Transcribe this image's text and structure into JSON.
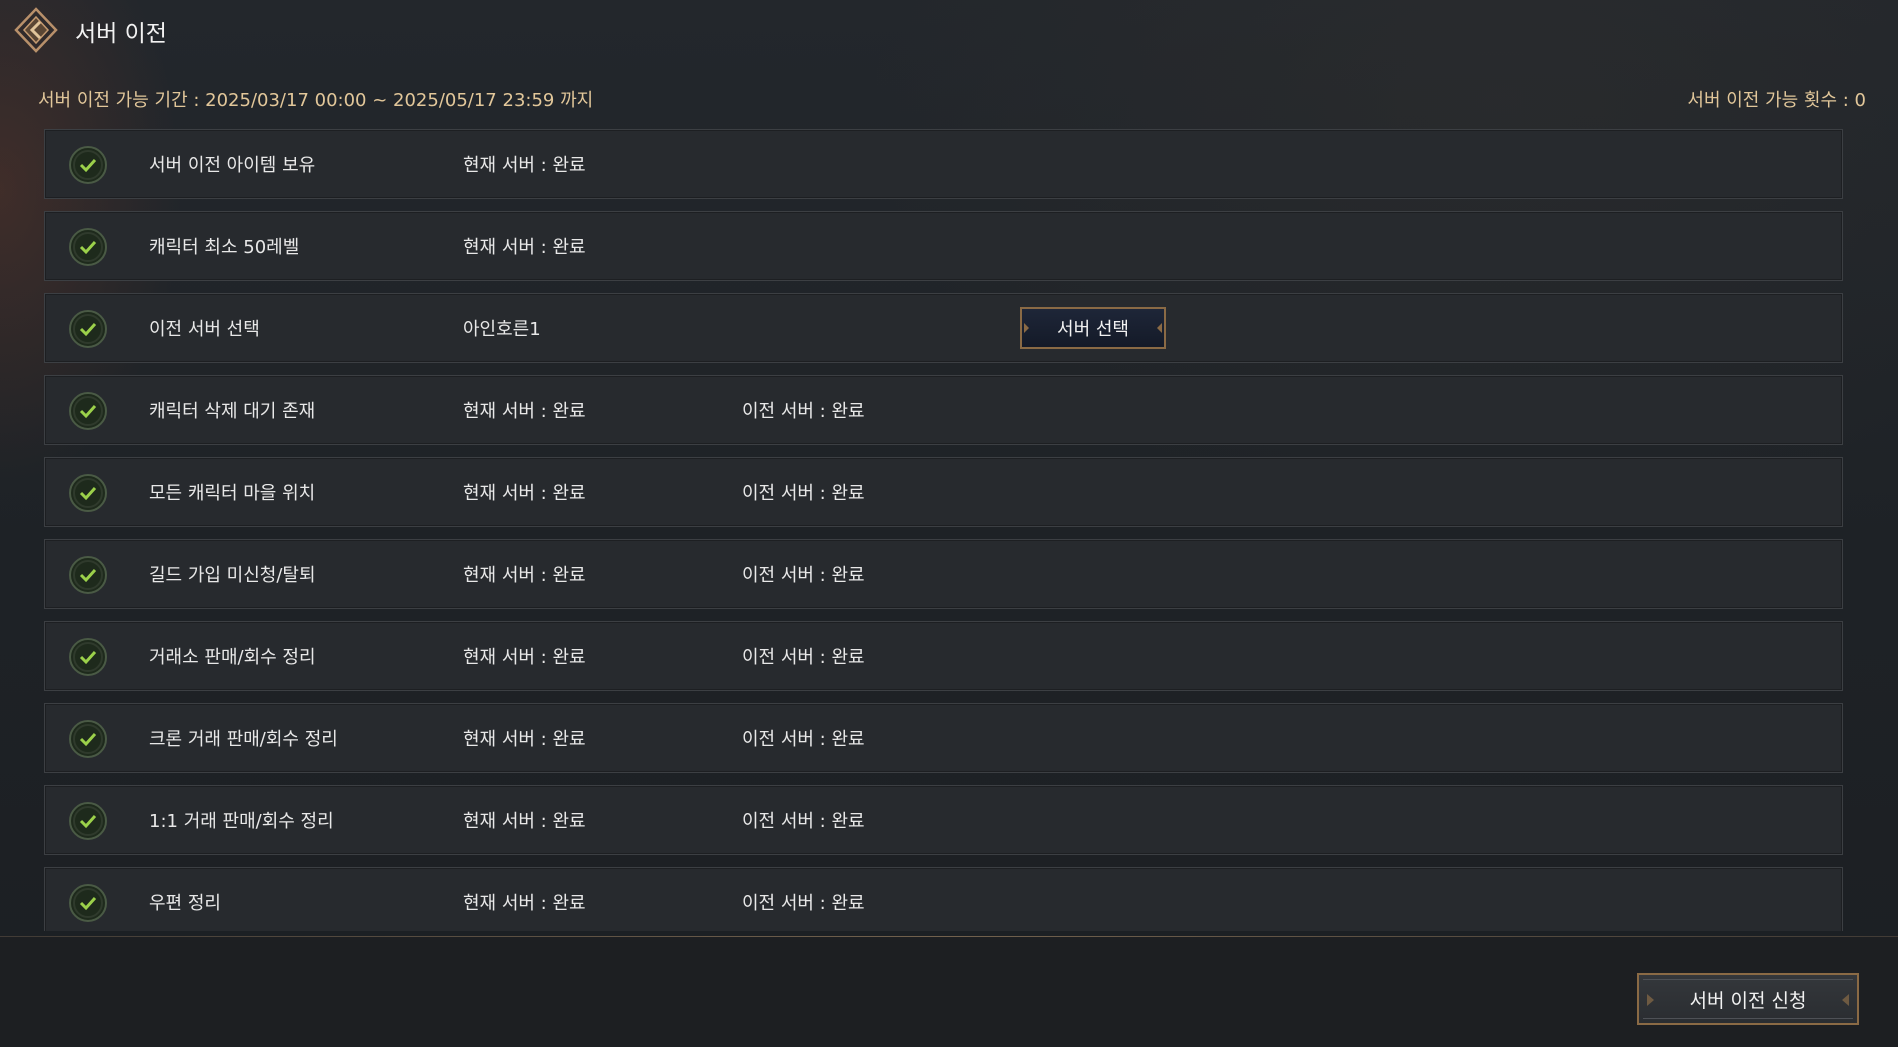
{
  "header": {
    "title": "서버 이전",
    "back_icon": "back-arrow-icon"
  },
  "info": {
    "period": "서버 이전 가능 기간 : 2025/03/17 00:00 ~ 2025/05/17 23:59 까지",
    "count": "서버 이전 가능 횟수 : 0"
  },
  "colors": {
    "accent_gold": "#e2c79a",
    "check_green": "#9bd14a",
    "border_bronze": "#8a6a45"
  },
  "requirements": [
    {
      "label": "서버 이전 아이템 보유",
      "current": "현재 서버 : 완료",
      "destination": "",
      "icon": "check-icon"
    },
    {
      "label": "캐릭터 최소 50레벨",
      "current": "현재 서버 : 완료",
      "destination": "",
      "icon": "check-icon"
    },
    {
      "label": "이전 서버 선택",
      "current": "아인호른1",
      "destination": "",
      "icon": "check-icon",
      "button": "서버 선택"
    },
    {
      "label": "캐릭터 삭제 대기 존재",
      "current": "현재 서버 : 완료",
      "destination": "이전 서버 : 완료",
      "icon": "check-icon"
    },
    {
      "label": "모든 캐릭터 마을 위치",
      "current": "현재 서버 : 완료",
      "destination": "이전 서버 : 완료",
      "icon": "check-icon"
    },
    {
      "label": "길드 가입 미신청/탈퇴",
      "current": "현재 서버 : 완료",
      "destination": "이전 서버 : 완료",
      "icon": "check-icon"
    },
    {
      "label": "거래소 판매/회수 정리",
      "current": "현재 서버 : 완료",
      "destination": "이전 서버 : 완료",
      "icon": "check-icon"
    },
    {
      "label": "크론 거래 판매/회수 정리",
      "current": "현재 서버 : 완료",
      "destination": "이전 서버 : 완료",
      "icon": "check-icon"
    },
    {
      "label": "1:1 거래 판매/회수 정리",
      "current": "현재 서버 : 완료",
      "destination": "이전 서버 : 완료",
      "icon": "check-icon"
    },
    {
      "label": "우편 정리",
      "current": "현재 서버 : 완료",
      "destination": "이전 서버 : 완료",
      "icon": "check-icon"
    }
  ],
  "footer": {
    "apply_label": "서버 이전 신청"
  }
}
